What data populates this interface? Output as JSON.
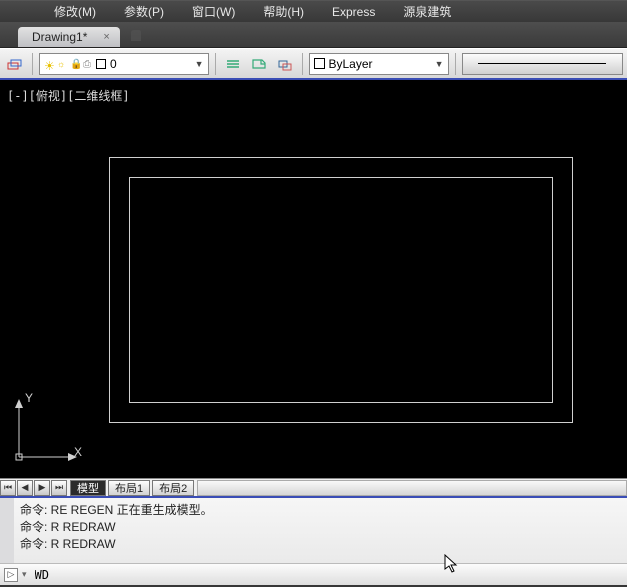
{
  "menu": {
    "modify": "修改(M)",
    "params": "参数(P)",
    "window": "窗口(W)",
    "help": "帮助(H)",
    "express": "Express",
    "yq": "源泉建筑"
  },
  "file_tab": {
    "name": "Drawing1*",
    "close": "×"
  },
  "toolbar": {
    "layer_dropdown_text": "0",
    "bylayer_text": "ByLayer"
  },
  "viewport": {
    "label": "[-][俯视][二维线框]",
    "ucs_y": "Y",
    "ucs_x": "X"
  },
  "layout_tabs": {
    "model": "模型",
    "layout1": "布局1",
    "layout2": "布局2"
  },
  "command": {
    "lines": [
      "命令: RE REGEN 正在重生成模型。",
      "命令: R REDRAW",
      "命令: R REDRAW"
    ],
    "input_value": "WD"
  }
}
